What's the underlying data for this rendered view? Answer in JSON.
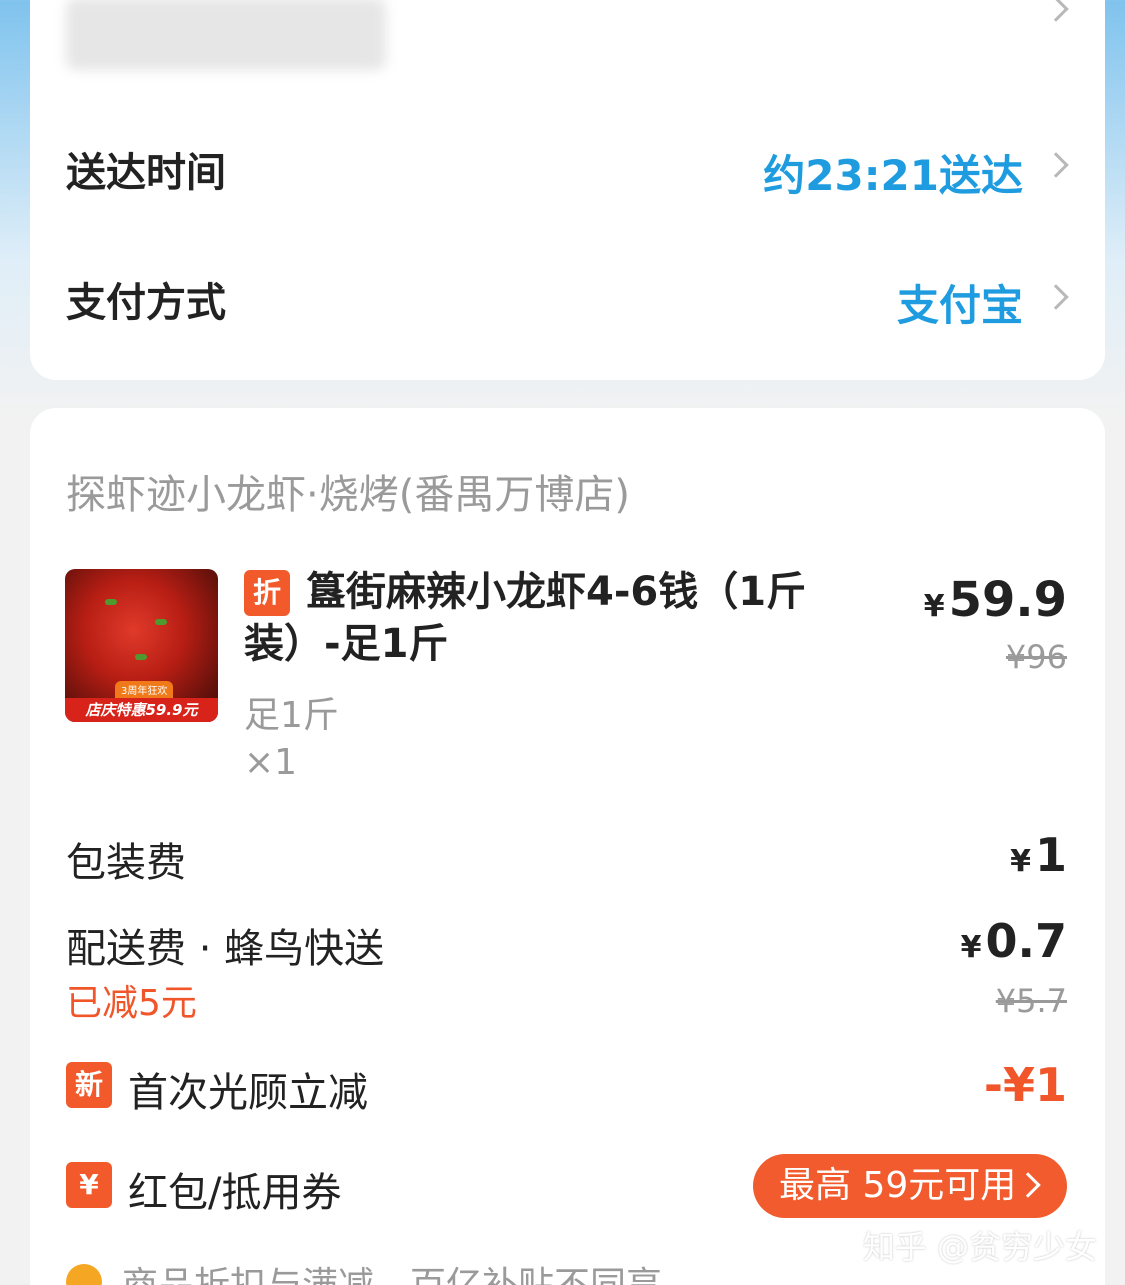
{
  "delivery": {
    "time_label": "送达时间",
    "time_value": "约23:21送达",
    "payment_label": "支付方式",
    "payment_value": "支付宝"
  },
  "order": {
    "shop_name": "探虾迹小龙虾·烧烤(番禺万博店)",
    "item": {
      "thumb_badge_top": "3周年狂欢",
      "thumb_badge": "店庆特惠59.9元",
      "tag": "折",
      "title": "簋街麻辣小龙虾4-6钱（1斤装）-足1斤",
      "spec": "足1斤",
      "quantity": "×1",
      "price_currency": "¥",
      "price": "59.9",
      "original_price": "¥96"
    },
    "packaging": {
      "label": "包装费",
      "currency": "¥",
      "value": "1"
    },
    "delivery_fee": {
      "label": "配送费 · 蜂鸟快送",
      "reduced_note": "已减5元",
      "currency": "¥",
      "value": "0.7",
      "original": "¥5.7"
    },
    "first_visit": {
      "tag": "新",
      "label": "首次光顾立减",
      "value": "-¥1"
    },
    "coupon": {
      "tag": "¥",
      "label": "红包/抵用券",
      "button_label": "最高 59元可用"
    },
    "notice": "商品折扣与满减、百亿补贴不同享"
  },
  "watermark": "知乎 @贫穷少女",
  "colors": {
    "accent_blue": "#1f9cdf",
    "accent_orange": "#f15b2e",
    "muted": "#9a9a9a"
  }
}
